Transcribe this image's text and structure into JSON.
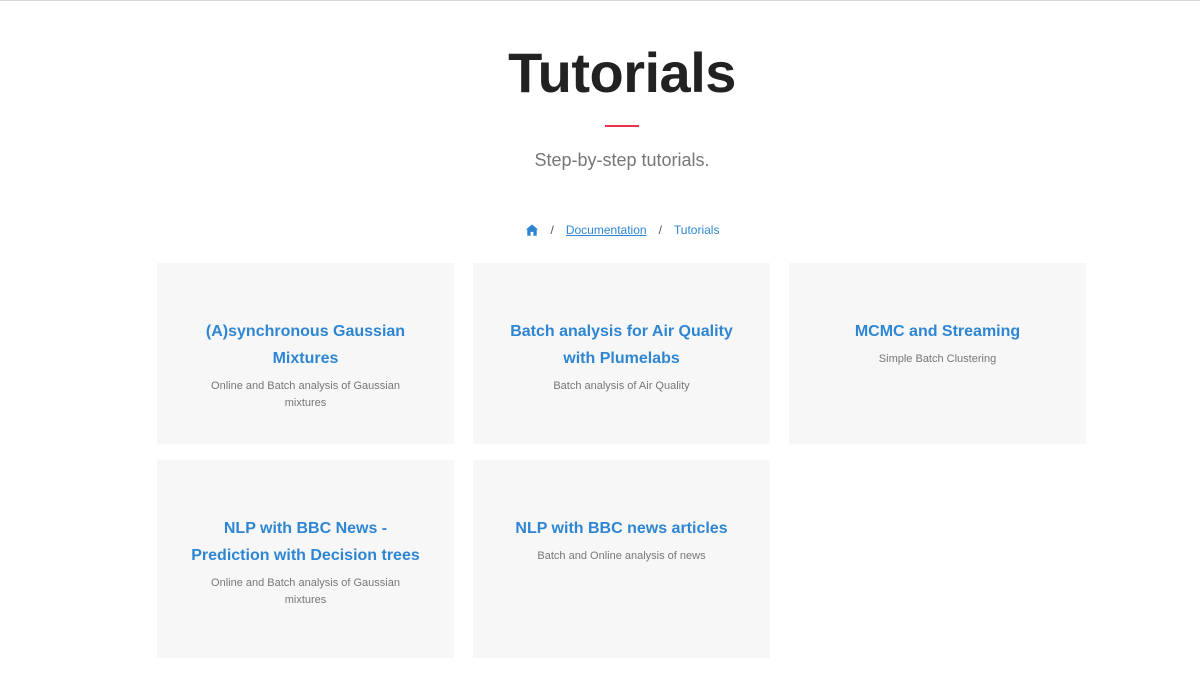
{
  "header": {
    "title": "Tutorials",
    "subtitle": "Step-by-step tutorials.",
    "accent_color": "#e8334a"
  },
  "breadcrumb": {
    "home_icon": "home-icon",
    "items": [
      {
        "label": "Documentation"
      },
      {
        "label": "Tutorials"
      }
    ],
    "separator": "/",
    "link_color": "#2e86d3"
  },
  "cards": [
    {
      "title": "(A)synchronous Gaussian Mixtures",
      "description": "Online and Batch analysis of Gaussian mixtures"
    },
    {
      "title": "Batch analysis for Air Quality with Plumelabs",
      "description": "Batch analysis of Air Quality"
    },
    {
      "title": "MCMC and Streaming",
      "description": "Simple Batch Clustering"
    },
    {
      "title": "NLP with BBC News - Prediction with Decision trees",
      "description": "Online and Batch analysis of Gaussian mixtures"
    },
    {
      "title": "NLP with BBC news articles",
      "description": "Batch and Online analysis of news"
    }
  ]
}
